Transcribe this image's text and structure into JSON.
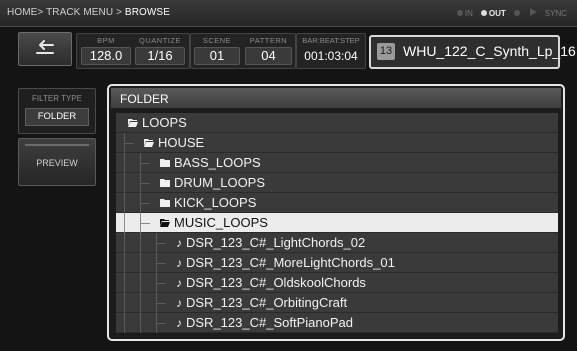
{
  "topbar": {
    "breadcrumb": [
      "HOME",
      "TRACK MENU",
      "BROWSE"
    ],
    "separator": ">",
    "status": {
      "in": "IN",
      "out": "OUT",
      "sync": "SYNC"
    }
  },
  "info": {
    "bpm_label": "BPM",
    "bpm": "128.0",
    "quantize_label": "QUANTIZE",
    "quantize": "1/16",
    "scene_label": "SCENE",
    "scene": "01",
    "pattern_label": "PATTERN",
    "pattern": "04",
    "barbeat_label": "BAR:BEAT:STEP",
    "barbeat": "001:03:04"
  },
  "track": {
    "number": "13",
    "name": "WHU_122_C_Synth_Lp_16"
  },
  "filter": {
    "label": "FILTER TYPE",
    "value": "FOLDER"
  },
  "preview": {
    "label": "PREVIEW"
  },
  "browser": {
    "title": "FOLDER",
    "items": [
      {
        "label": "LOOPS",
        "type": "folder-open",
        "depth": 0
      },
      {
        "label": "HOUSE",
        "type": "folder-open",
        "depth": 1
      },
      {
        "label": "BASS_LOOPS",
        "type": "folder",
        "depth": 2
      },
      {
        "label": "DRUM_LOOPS",
        "type": "folder",
        "depth": 2
      },
      {
        "label": "KICK_LOOPS",
        "type": "folder",
        "depth": 2
      },
      {
        "label": "MUSIC_LOOPS",
        "type": "folder-open",
        "depth": 2,
        "selected": true
      },
      {
        "label": "DSR_123_C#_LightChords_02",
        "type": "file",
        "depth": 3
      },
      {
        "label": "DSR_123_C#_MoreLightChords_01",
        "type": "file",
        "depth": 3
      },
      {
        "label": "DSR_123_C#_OldskoolChords",
        "type": "file",
        "depth": 3
      },
      {
        "label": "DSR_123_C#_OrbitingCraft",
        "type": "file",
        "depth": 3
      },
      {
        "label": "DSR_123_C#_SoftPianoPad",
        "type": "file",
        "depth": 3
      }
    ]
  }
}
